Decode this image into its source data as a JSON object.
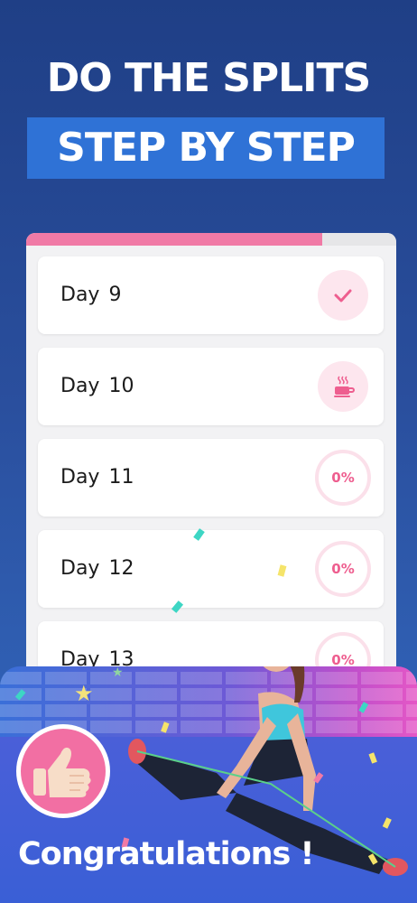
{
  "header": {
    "title": "DO THE SPLITS",
    "subtitle": "STEP BY STEP"
  },
  "plan": {
    "progress_fraction": 0.8,
    "colors": {
      "accent": "#f07aa6",
      "track": "#e6e6e8"
    },
    "days": [
      {
        "label": "Day",
        "number": "9",
        "status": "completed",
        "icon": "check-icon"
      },
      {
        "label": "Day",
        "number": "10",
        "status": "rest",
        "icon": "coffee-cup-icon"
      },
      {
        "label": "Day",
        "number": "11",
        "status": "progress",
        "percent_text": "0%"
      },
      {
        "label": "Day",
        "number": "12",
        "status": "progress",
        "percent_text": "0%"
      },
      {
        "label": "Day",
        "number": "13",
        "status": "progress",
        "percent_text": "0%"
      }
    ]
  },
  "celebration": {
    "message": "Congratulations !",
    "badge_icon": "thumbs-up-icon"
  }
}
